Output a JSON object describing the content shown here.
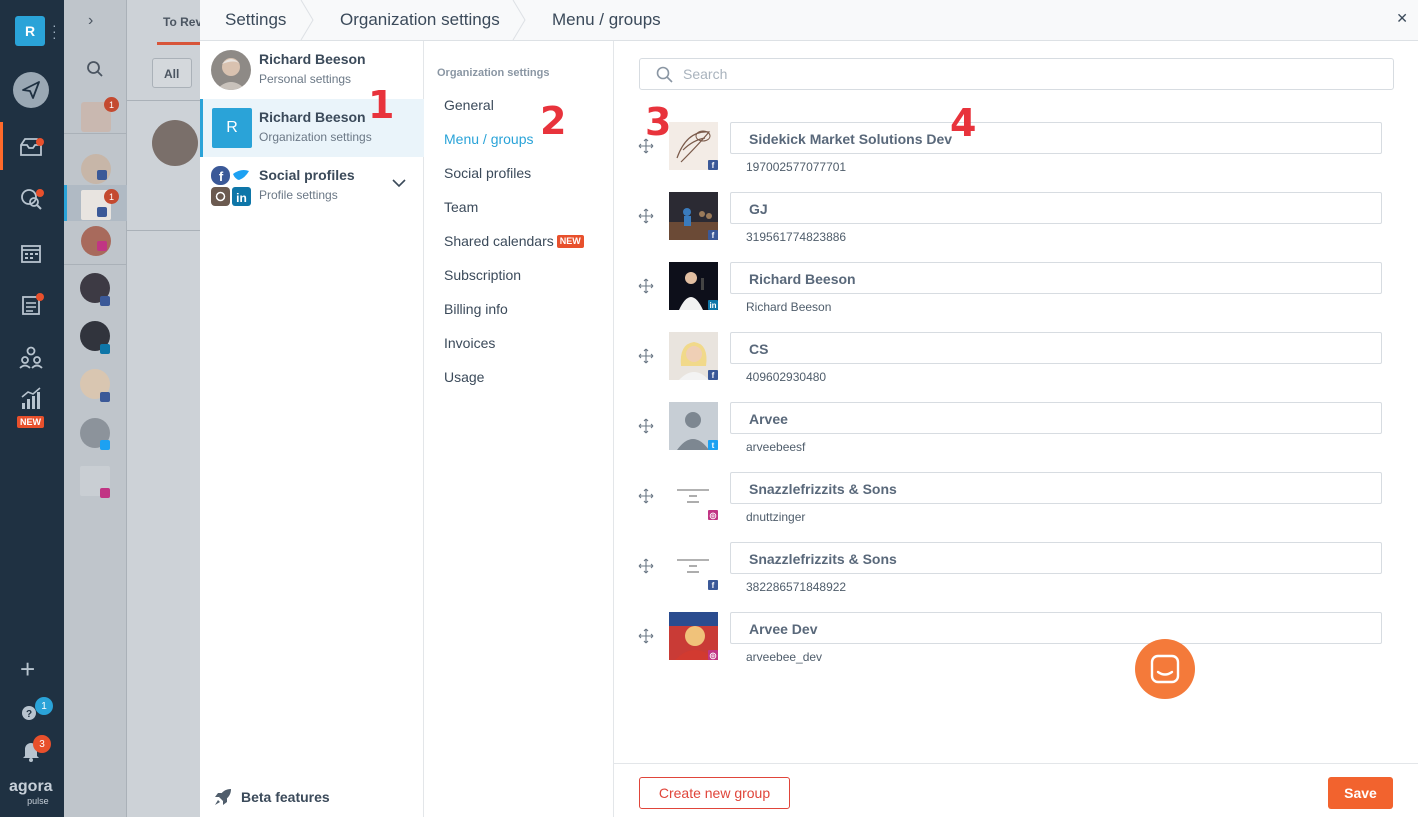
{
  "app_rail": {
    "workspace_initial": "R",
    "new_label": "NEW",
    "help_badge": "1",
    "notifications_badge": "3",
    "brand_top": "agora",
    "brand_bottom": "pulse"
  },
  "background": {
    "tab_label": "To Rev",
    "filter_label": "All",
    "counts": [
      "1",
      "1"
    ]
  },
  "breadcrumb": {
    "items": [
      "Settings",
      "Organization settings",
      "Menu / groups"
    ]
  },
  "accounts": [
    {
      "name": "Richard Beeson",
      "desc": "Personal settings"
    },
    {
      "name": "Richard Beeson",
      "desc": "Organization settings",
      "initial": "R"
    },
    {
      "name": "Social profiles",
      "desc": "Profile settings"
    }
  ],
  "beta_label": "Beta features",
  "nav": {
    "header": "Organization settings",
    "items": [
      "General",
      "Menu / groups",
      "Social profiles",
      "Team",
      "Shared calendars",
      "Subscription",
      "Billing info",
      "Invoices",
      "Usage"
    ],
    "new_badge": "NEW"
  },
  "search": {
    "placeholder": "Search"
  },
  "groups": [
    {
      "name": "Sidekick Market Solutions Dev",
      "id": "197002577077701",
      "network": "facebook"
    },
    {
      "name": "GJ",
      "id": "319561774823886",
      "network": "facebook"
    },
    {
      "name": "Richard Beeson",
      "id": "Richard Beeson",
      "network": "linkedin"
    },
    {
      "name": "CS",
      "id": "409602930480",
      "network": "facebook"
    },
    {
      "name": "Arvee",
      "id": "arveebeesf",
      "network": "twitter"
    },
    {
      "name": "Snazzlefrizzits & Sons",
      "id": "dnuttzinger",
      "network": "instagram"
    },
    {
      "name": "Snazzlefrizzits & Sons",
      "id": "382286571848922",
      "network": "facebook"
    },
    {
      "name": "Arvee Dev",
      "id": "arveebee_dev",
      "network": "instagram"
    }
  ],
  "annotations": [
    "1",
    "2",
    "3",
    "4"
  ],
  "footer": {
    "create_label": "Create new group",
    "save_label": "Save"
  },
  "colors": {
    "accent": "#2aa3d8",
    "brand_orange": "#f2632e",
    "facebook": "#3b5998",
    "linkedin": "#0e76a8",
    "twitter": "#1da1f2",
    "instagram": "#c13584",
    "annotation_red": "#e8333c"
  }
}
